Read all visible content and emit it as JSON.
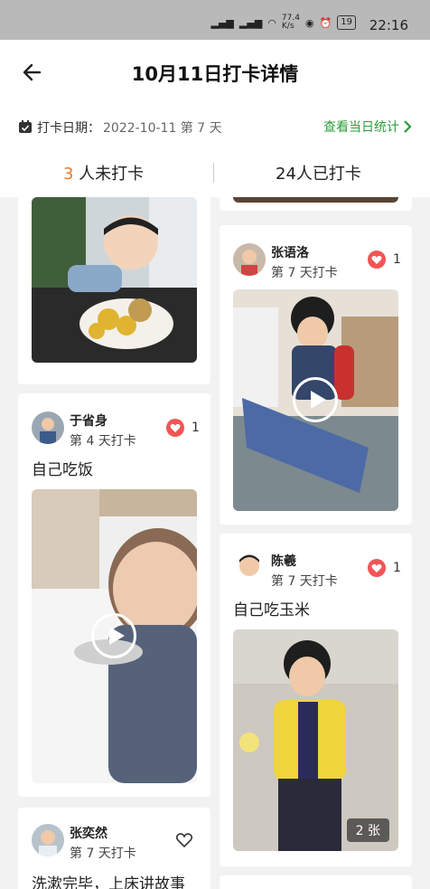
{
  "statusbar": {
    "time": "22:16",
    "speed": "77.4\nK/s",
    "battery": "19"
  },
  "header": {
    "title": "10月11日打卡详情"
  },
  "datebar": {
    "label": "打卡日期：",
    "value": "2022-10-11 第 7 天",
    "stats_link": "查看当日统计"
  },
  "tabs": {
    "not_checked_num": "3",
    "not_checked_text": " 人未打卡",
    "checked": "24人已打卡"
  },
  "colors": {
    "accent_green": "#2a9d3a",
    "accent_orange": "#e57b2d",
    "like_red": "#f25555"
  },
  "posts": [
    {
      "name": "于省身",
      "days": "第 4 天打卡",
      "likes": "1",
      "caption": "自己吃饭"
    },
    {
      "name": "张奕然",
      "days": "第 7 天打卡",
      "caption": "洗漱完毕，上床讲故事"
    },
    {
      "name": "张语洛",
      "days": "第 7 天打卡",
      "likes": "1"
    },
    {
      "name": "陈羲",
      "days": "第 7 天打卡",
      "likes": "1",
      "caption": "自己吃玉米",
      "photo_count": "2 张"
    }
  ]
}
